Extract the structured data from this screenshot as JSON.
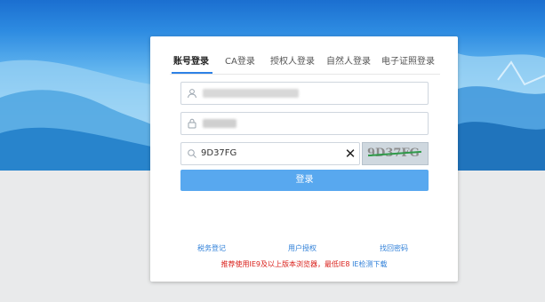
{
  "tabs": [
    {
      "label": "账号登录",
      "active": true
    },
    {
      "label": "CA登录",
      "active": false
    },
    {
      "label": "授权人登录",
      "active": false
    },
    {
      "label": "自然人登录",
      "active": false
    },
    {
      "label": "电子证照登录",
      "active": false
    }
  ],
  "form": {
    "username_icon": "user-icon",
    "password_icon": "lock-icon",
    "captcha_icon": "search-icon",
    "captcha_value": "9D37FG",
    "clear_symbol": "✕",
    "captcha_image_text": "9D37FG",
    "login_label": "登录"
  },
  "links": {
    "register": "税务登记",
    "authorize": "用户授权",
    "recover": "找回密码"
  },
  "notice": {
    "text": "推荐使用IE9及以上版本浏览器，最低IE8",
    "link": "IE检测下载"
  },
  "colors": {
    "accent": "#2e82e6",
    "button": "#58a8ef",
    "link": "#2e7fd8",
    "warning": "#d91e18"
  }
}
